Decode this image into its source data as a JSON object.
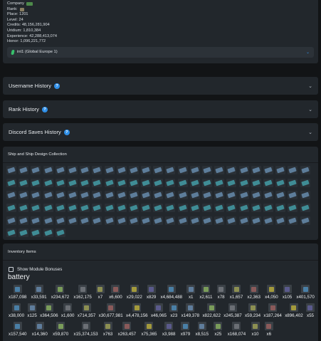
{
  "profile": {
    "company_label": "Company",
    "rank_label": "Rank:",
    "place": "Place: 1201",
    "level": "Level: 24",
    "credits": "Credits: 48,156,281,904",
    "uridium": "Uridium: 1,810,384",
    "experience": "Experience: 42,288,413,074",
    "honor": "Honor: 1,096,221,772",
    "server_select": "int1 (Global Europe 1)"
  },
  "sections": {
    "username_history": "Username History",
    "rank_history": "Rank History",
    "discord_saves_history": "Discord Saves History",
    "ships_title": "Ship and Ship Design Collection",
    "inventory_title": "Inventory Items"
  },
  "inventory": {
    "show_module_bonuses": "Show Module Bonuses",
    "category": "battery",
    "row1": [
      "x187,098",
      "x33,591",
      "x234,672",
      "x162,175",
      "x7",
      "x6,600",
      "x29,022",
      "x829",
      "x4,684,488",
      "x1",
      "x2,611",
      "x78",
      "x1,657",
      "x2,363",
      "x4,050",
      "x105",
      "x401,570"
    ],
    "row2": [
      "x38,000",
      "x125",
      "x364,506",
      "x1,600",
      "x714,357",
      "x30,677,981",
      "x4,478,156",
      "x46,065",
      "x23",
      "x149,378",
      "x822,622",
      "x245,387",
      "x59,234",
      "x187,264",
      "x896,402",
      "x55"
    ],
    "row3": [
      "x157,540",
      "x14,360",
      "x59,870",
      "x15,374,153",
      "x763",
      "x263,457",
      "x75,365",
      "x3,988",
      "x979",
      "x8,515",
      "x25",
      "x168,074",
      "x10",
      "x6"
    ]
  },
  "colors": {
    "page_bg": "#121416",
    "card_bg": "#22272c",
    "accent_blue": "#2f8fe8",
    "server_gem": "#38c06c"
  }
}
